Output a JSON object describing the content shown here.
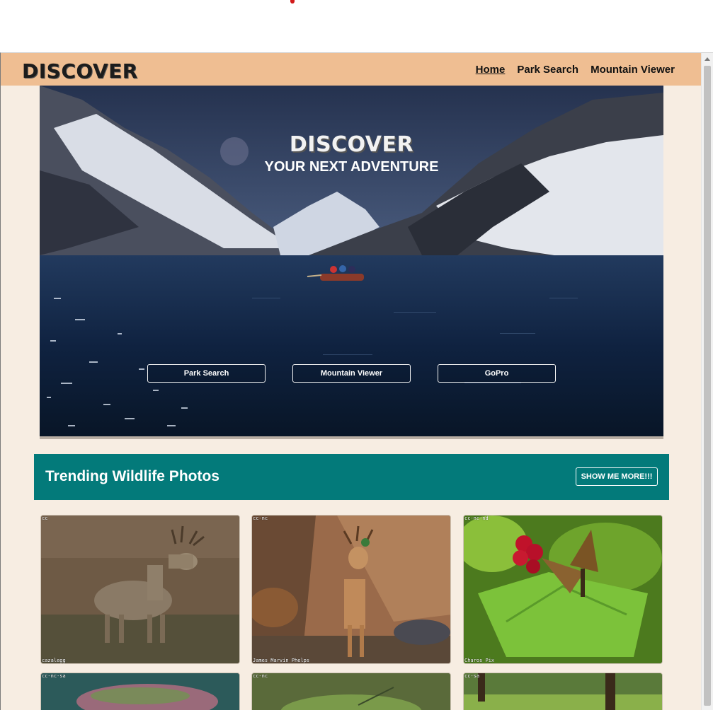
{
  "colors": {
    "navbar": "#efbe92",
    "page_bg": "#f7ede2",
    "trend_bar": "#037a7a"
  },
  "nav": {
    "logo": "DISCOVER",
    "links": [
      "Home",
      "Park Search",
      "Mountain Viewer"
    ]
  },
  "hero": {
    "title": "DISCOVER",
    "subtitle": "YOUR NEXT ADVENTURE",
    "buttons": [
      "Park Search",
      "Mountain Viewer",
      "GoPro"
    ]
  },
  "trending": {
    "title": "Trending Wildlife Photos",
    "button": "SHOW ME MORE!!!"
  },
  "photos": [
    {
      "license": "cc",
      "credit": "cazalegg"
    },
    {
      "license": "cc-nc",
      "credit": "James Marvin Phelps"
    },
    {
      "license": "cc-nc-nd",
      "credit": "Charos Pix"
    },
    {
      "license": "cc-nc-sa",
      "credit": ""
    },
    {
      "license": "cc-nc",
      "credit": ""
    },
    {
      "license": "cc-sa",
      "credit": ""
    }
  ]
}
